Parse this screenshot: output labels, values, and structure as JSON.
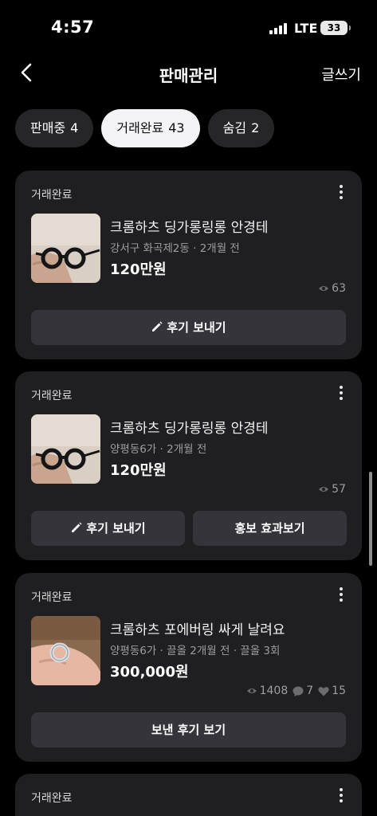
{
  "status_bar": {
    "time": "4:57",
    "network": "LTE",
    "battery": "33"
  },
  "nav": {
    "title": "판매관리",
    "write_label": "글쓰기"
  },
  "tabs": [
    {
      "label": "판매중",
      "count": "4",
      "active": false
    },
    {
      "label": "거래완료",
      "count": "43",
      "active": true
    },
    {
      "label": "숨김",
      "count": "2",
      "active": false
    }
  ],
  "items": [
    {
      "status": "거래완료",
      "title": "크롬하츠 딩가롱링롱 안경테",
      "meta": "강서구 화곡제2동 · 2개월 전",
      "price": "120만원",
      "views": "63",
      "thumb_icon": "glasses-photo",
      "buttons": [
        "후기 보내기"
      ]
    },
    {
      "status": "거래완료",
      "title": "크롬하츠 딩가롱링롱 안경테",
      "meta": "양평동6가 · 2개월 전",
      "price": "120만원",
      "views": "57",
      "thumb_icon": "glasses-photo",
      "buttons": [
        "후기 보내기",
        "홍보 효과보기"
      ]
    },
    {
      "status": "거래완료",
      "title": "크롬하츠 포에버링 싸게 날려요",
      "meta": "양평동6가 · 끌올 2개월 전 · 끌올 3회",
      "price": "300,000원",
      "views": "1408",
      "chats": "7",
      "likes": "15",
      "thumb_icon": "ring-photo",
      "buttons": [
        "보낸 후기 보기"
      ]
    },
    {
      "status": "거래완료"
    }
  ]
}
